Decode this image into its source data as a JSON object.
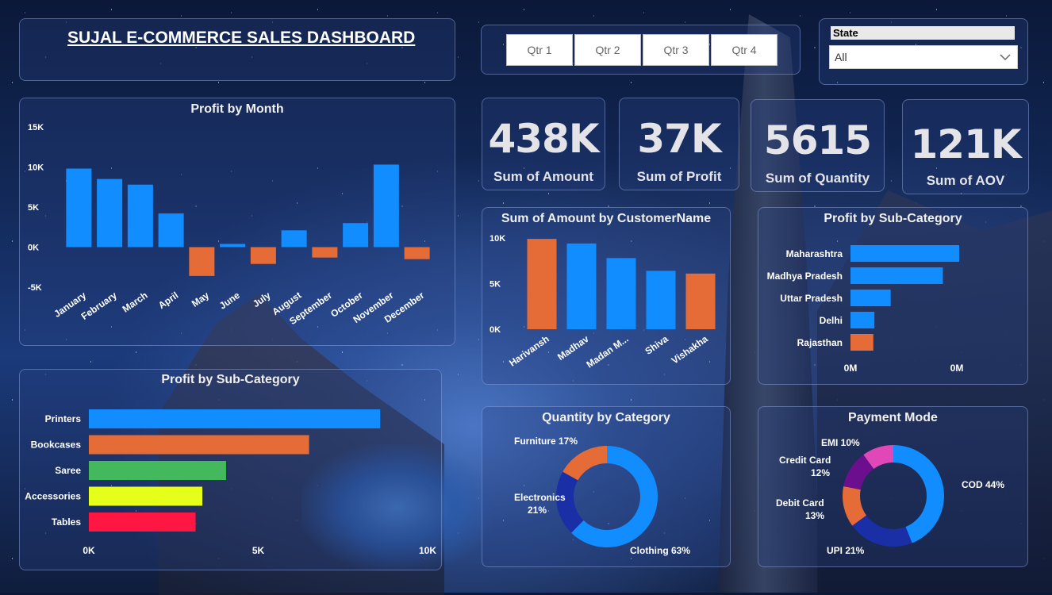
{
  "title": "SUJAL E-COMMERCE SALES DASHBOARD",
  "quarters": [
    "Qtr 1",
    "Qtr 2",
    "Qtr 3",
    "Qtr 4"
  ],
  "state_filter": {
    "label": "State",
    "value": "All"
  },
  "kpis": [
    {
      "value": "438K",
      "label": "Sum of Amount"
    },
    {
      "value": "37K",
      "label": "Sum of Profit"
    },
    {
      "value": "5615",
      "label": "Sum of Quantity"
    },
    {
      "value": "121K",
      "label": "Sum of AOV"
    }
  ],
  "colors": {
    "positive": "#118dff",
    "negative": "#e66c37"
  },
  "chart_data": [
    {
      "id": "profit_by_month",
      "type": "bar",
      "title": "Profit by Month",
      "categories": [
        "January",
        "February",
        "March",
        "April",
        "May",
        "June",
        "July",
        "August",
        "September",
        "October",
        "November",
        "December"
      ],
      "values": [
        9800,
        8500,
        7800,
        4200,
        -3600,
        400,
        -2100,
        2100,
        -1300,
        3000,
        10300,
        -1500
      ],
      "ylim": [
        -5000,
        15000
      ],
      "yticks": [
        -5000,
        0,
        5000,
        10000,
        15000
      ],
      "ytick_labels": [
        "-5K",
        "0K",
        "5K",
        "10K",
        "15K"
      ]
    },
    {
      "id": "amount_by_customer",
      "type": "bar",
      "title": "Sum of Amount by CustomerName",
      "categories": [
        "Harivansh",
        "Madhav",
        "Madan M...",
        "Shiva",
        "Vishakha"
      ],
      "values": [
        9900,
        9400,
        7800,
        6400,
        6100
      ],
      "colors": [
        "#e66c37",
        "#118dff",
        "#118dff",
        "#118dff",
        "#e66c37"
      ],
      "ylim": [
        0,
        10000
      ],
      "yticks": [
        0,
        5000,
        10000
      ],
      "ytick_labels": [
        "0K",
        "5K",
        "10K"
      ]
    },
    {
      "id": "profit_by_state",
      "type": "bar",
      "title": "Profit by Sub-Category",
      "categories": [
        "Maharashtra",
        "Madhya Pradesh",
        "Uttar Pradesh",
        "Delhi",
        "Rajasthan"
      ],
      "values": [
        100,
        85,
        37,
        22,
        21
      ],
      "colors": [
        "#118dff",
        "#118dff",
        "#118dff",
        "#118dff",
        "#e66c37"
      ],
      "xtick_labels": [
        "0M",
        "0M"
      ]
    },
    {
      "id": "profit_by_subcategory",
      "type": "bar",
      "title": "Profit by Sub-Category",
      "categories": [
        "Printers",
        "Bookcases",
        "Saree",
        "Accessories",
        "Tables"
      ],
      "values": [
        8600,
        6500,
        4050,
        3350,
        3150
      ],
      "colors": [
        "#118dff",
        "#e66c37",
        "#44b85c",
        "#e6ff1a",
        "#ff1744"
      ],
      "xlim": [
        0,
        10000
      ],
      "xticks": [
        0,
        5000,
        10000
      ],
      "xtick_labels": [
        "0K",
        "5K",
        "10K"
      ]
    },
    {
      "id": "quantity_by_category",
      "type": "pie",
      "title": "Quantity by Category",
      "labels": [
        "Clothing",
        "Electronics",
        "Furniture"
      ],
      "values": [
        63,
        21,
        17
      ],
      "display": [
        "Clothing 63%",
        "Electronics 21%",
        "Furniture 17%"
      ],
      "colors": [
        "#118dff",
        "#1a2fa6",
        "#e66c37"
      ]
    },
    {
      "id": "payment_mode",
      "type": "pie",
      "title": "Payment Mode",
      "labels": [
        "COD",
        "UPI",
        "Debit Card",
        "Credit Card",
        "EMI"
      ],
      "values": [
        44,
        21,
        13,
        12,
        10
      ],
      "display": [
        "COD 44%",
        "UPI 21%",
        "Debit Card 13%",
        "Credit Card 12%",
        "EMI 10%"
      ],
      "colors": [
        "#118dff",
        "#1a2fa6",
        "#e66c37",
        "#6b0f8f",
        "#e048b8"
      ]
    }
  ]
}
